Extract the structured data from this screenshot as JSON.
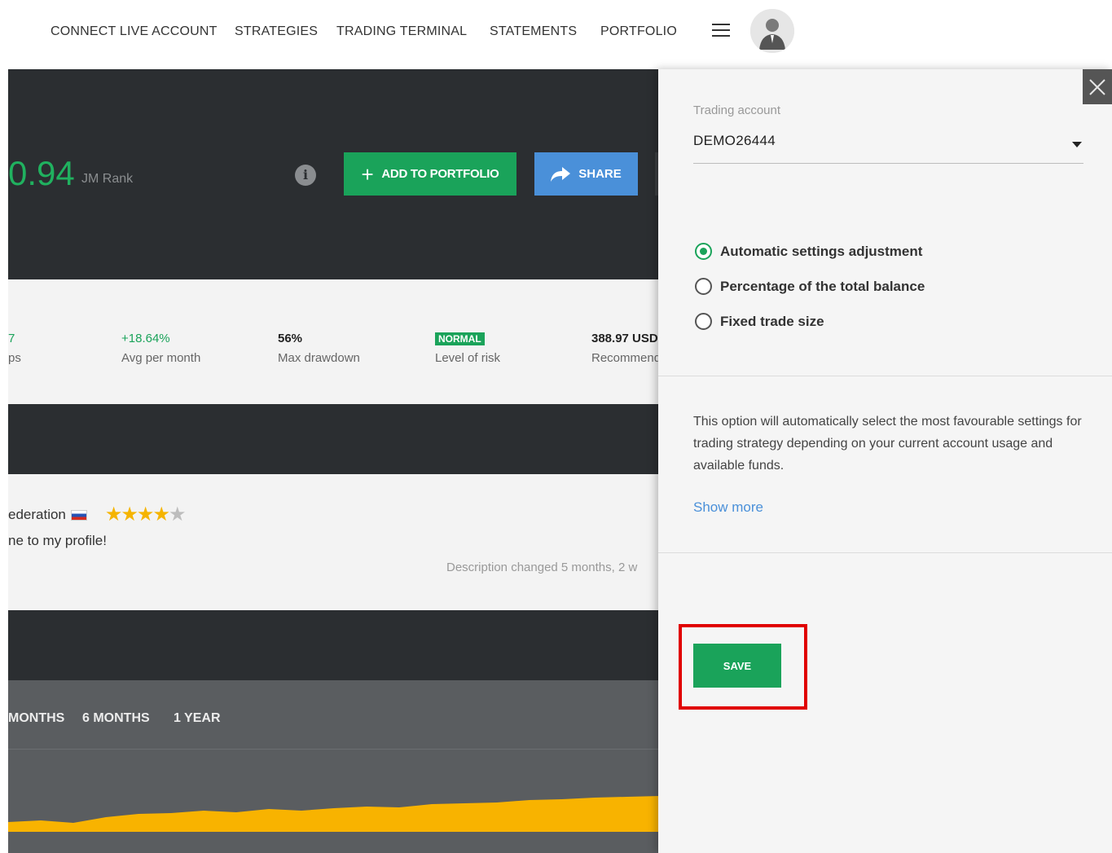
{
  "nav": {
    "items": [
      "CONNECT LIVE ACCOUNT",
      "STRATEGIES",
      "TRADING TERMINAL",
      "STATEMENTS",
      "PORTFOLIO"
    ]
  },
  "hero": {
    "rank_value": "0.94",
    "rank_label": "JM Rank",
    "add_label": "ADD TO PORTFOLIO",
    "share_label": "SHARE"
  },
  "stats": [
    {
      "value": "7",
      "label": "ps"
    },
    {
      "value": "+18.64%",
      "label": "Avg per month"
    },
    {
      "value": "56%",
      "label": "Max drawdown"
    },
    {
      "value": "NORMAL",
      "label": "Level of risk"
    },
    {
      "value": "388.97 USD",
      "label": "Recommended"
    }
  ],
  "profile": {
    "country": "ederation",
    "rating": 4,
    "rating_max": 5,
    "welcome": "ne to my profile!",
    "desc_changed": "Description changed 5 months, 2 w"
  },
  "chart": {
    "periods": [
      "MONTHS",
      "6 MONTHS",
      "1 YEAR"
    ],
    "line_color": "#f8b300"
  },
  "drawer": {
    "account_label": "Trading account",
    "account_value": "DEMO26444",
    "options": [
      {
        "label": "Automatic settings adjustment",
        "selected": true
      },
      {
        "label": "Percentage of the total balance",
        "selected": false
      },
      {
        "label": "Fixed trade size",
        "selected": false
      }
    ],
    "help": "This option will automatically select the most favourable settings for trading strategy depending on your current account usage and available funds.",
    "show_more": "Show more",
    "save_label": "SAVE"
  },
  "colors": {
    "accent_green": "#1aa35a",
    "share_blue": "#4a90d9",
    "highlight_red": "#e00000"
  }
}
